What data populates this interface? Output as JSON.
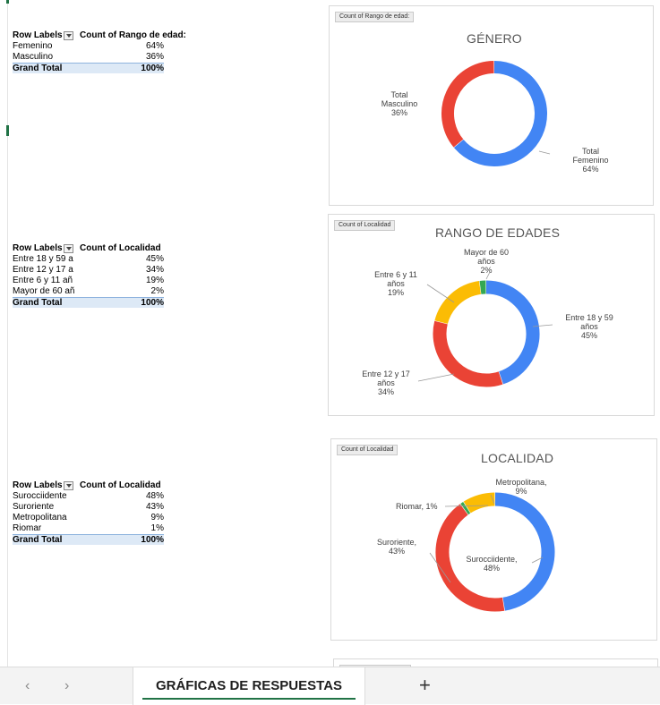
{
  "pivots": [
    {
      "col1_header": "Row Labels",
      "col2_header": "Count of Rango de edad:",
      "rows": [
        {
          "label": "Femenino",
          "value": "64%"
        },
        {
          "label": "Masculino",
          "value": "36%"
        }
      ],
      "total_label": "Grand Total",
      "total_value": "100%"
    },
    {
      "col1_header": "Row Labels",
      "col2_header": "Count of Localidad",
      "rows": [
        {
          "label": "Entre 18 y 59 a",
          "value": "45%"
        },
        {
          "label": "Entre 12 y 17 a",
          "value": "34%"
        },
        {
          "label": "Entre 6 y 11 añ",
          "value": "19%"
        },
        {
          "label": "Mayor de 60 añ",
          "value": "2%"
        }
      ],
      "total_label": "Grand Total",
      "total_value": "100%"
    },
    {
      "col1_header": "Row Labels",
      "col2_header": "Count of Localidad",
      "rows": [
        {
          "label": "Surocciidente",
          "value": "48%"
        },
        {
          "label": "Suroriente",
          "value": "43%"
        },
        {
          "label": "Metropolitana",
          "value": "9%"
        },
        {
          "label": "Riomar",
          "value": "1%"
        }
      ],
      "total_label": "Grand Total",
      "total_value": "100%"
    }
  ],
  "chart_data": [
    {
      "type": "pie",
      "donut": true,
      "field_button": "Count of Rango de edad:",
      "title": "GÉNERO",
      "slices": [
        {
          "name": "Femenino",
          "value": 64,
          "color": "#4285f4",
          "label": [
            "Total",
            "Femenino",
            "64%"
          ]
        },
        {
          "name": "Masculino",
          "value": 36,
          "color": "#ea4335",
          "label": [
            "Total",
            "Masculino",
            "36%"
          ]
        }
      ]
    },
    {
      "type": "pie",
      "donut": true,
      "field_button": "Count of Localidad",
      "title": "RANGO DE EDADES",
      "slices": [
        {
          "name": "Entre 18 y 59 años",
          "value": 45,
          "color": "#4285f4",
          "label": [
            "Entre 18 y 59",
            "años",
            "45%"
          ]
        },
        {
          "name": "Entre 12 y 17 años",
          "value": 34,
          "color": "#ea4335",
          "label": [
            "Entre 12 y 17",
            "años",
            "34%"
          ]
        },
        {
          "name": "Entre 6 y 11 años",
          "value": 19,
          "color": "#fbbc04",
          "label": [
            "Entre 6 y 11",
            "años",
            "19%"
          ]
        },
        {
          "name": "Mayor de 60 años",
          "value": 2,
          "color": "#34a853",
          "label": [
            "Mayor de 60",
            "años",
            "2%"
          ]
        }
      ]
    },
    {
      "type": "pie",
      "donut": true,
      "field_button": "Count of Localidad",
      "title": "LOCALIDAD",
      "slices": [
        {
          "name": "Surocciidente",
          "value": 48,
          "color": "#4285f4",
          "label": [
            "Surocciidente,",
            "48%"
          ]
        },
        {
          "name": "Suroriente",
          "value": 43,
          "color": "#ea4335",
          "label": [
            "Suroriente,",
            "43%"
          ]
        },
        {
          "name": "Riomar",
          "value": 1,
          "color": "#34a853",
          "label": [
            "Riomar, 1%"
          ]
        },
        {
          "name": "Metropolitana",
          "value": 9,
          "color": "#fbbc04",
          "label": [
            "Metropolitana,",
            "9%"
          ]
        }
      ]
    }
  ],
  "tabbar": {
    "prev_icon": "‹",
    "next_icon": "›",
    "active_sheet": "GRÁFICAS DE RESPUESTAS",
    "add_icon": "+"
  }
}
